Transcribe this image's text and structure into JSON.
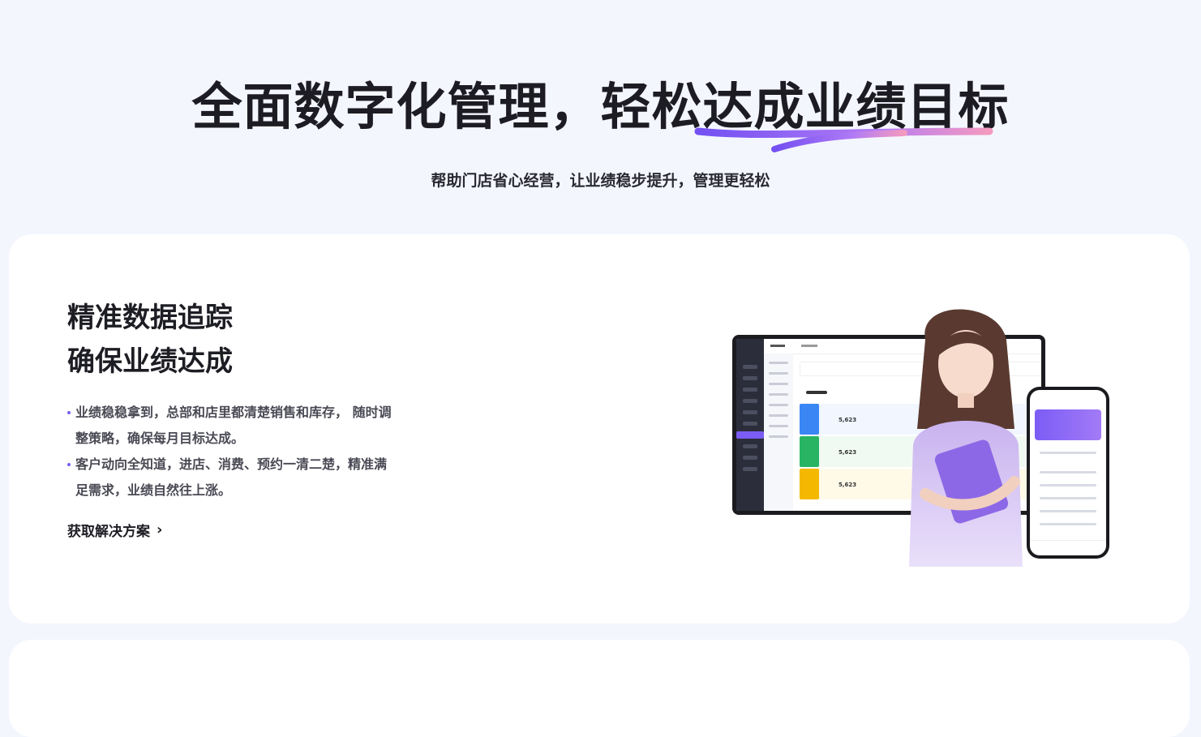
{
  "hero": {
    "title_part1": "全面数字化管理，轻松",
    "title_highlight": "达成业绩目标",
    "subtitle": "帮助门店省心经营，让业绩稳步提升，管理更轻松"
  },
  "feature": {
    "title_line1": "精准数据追踪",
    "title_line2_prefix": "确保",
    "title_line2_highlight": "业绩达成",
    "bullets": [
      "业绩稳稳拿到，总部和店里都清楚销售和库存， 随时调整策略，确保每月目标达成。",
      "客户动向全知道，进店、消费、预约一清二楚，精准满足需求，业绩自然往上涨。"
    ],
    "cta_label": "获取解决方案",
    "cta_icon": "chevron-right-icon"
  },
  "mockup": {
    "metric_value": "5,623"
  },
  "colors": {
    "accent": "#7b5cf5",
    "accent_pink": "#f29bbf",
    "background": "#f4f6fe"
  }
}
